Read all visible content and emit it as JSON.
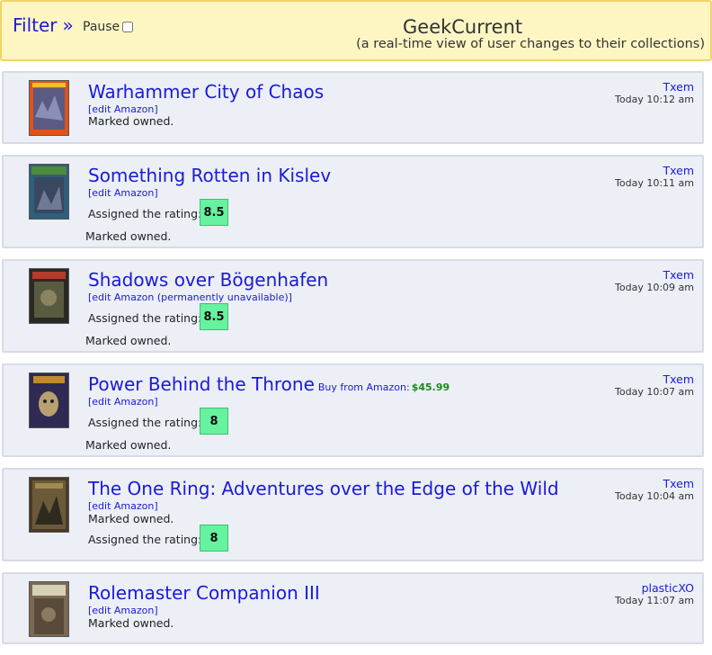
{
  "header": {
    "filter_label": "Filter",
    "filter_arrow": "»",
    "pause_label": "Pause",
    "pause_checked": false,
    "title": "GeekCurrent",
    "subtitle": "(a real-time view of user changes to their collections)"
  },
  "entries": [
    {
      "title": "Warhammer City of Chaos",
      "edit": "[edit Amazon]",
      "marked": "Marked owned.",
      "user": "Txem",
      "time": "Today 10:12 am"
    },
    {
      "title": "Something Rotten in Kislev",
      "edit": "[edit Amazon]",
      "rating_label": "Assigned the rating:",
      "rating": "8.5",
      "marked": "Marked owned.",
      "user": "Txem",
      "time": "Today 10:11 am"
    },
    {
      "title": "Shadows over Bögenhafen",
      "edit": "[edit Amazon (permanently unavailable)]",
      "rating_label": "Assigned the rating:",
      "rating": "8.5",
      "marked": "Marked owned.",
      "user": "Txem",
      "time": "Today 10:09 am"
    },
    {
      "title": "Power Behind the Throne",
      "buy_label": "Buy from Amazon:",
      "price": "$45.99",
      "edit": "[edit Amazon]",
      "rating_label": "Assigned the rating:",
      "rating": "8",
      "marked": "Marked owned.",
      "user": "Txem",
      "time": "Today 10:07 am"
    },
    {
      "title": "The One Ring: Adventures over the Edge of the Wild",
      "edit": "[edit Amazon]",
      "marked": "Marked owned.",
      "rating_label": "Assigned the rating:",
      "rating": "8",
      "user": "Txem",
      "time": "Today 10:04 am"
    },
    {
      "title": "Rolemaster Companion III",
      "edit": "[edit Amazon]",
      "marked": "Marked owned.",
      "user": "plasticXO",
      "time": "Today 11:07 am"
    }
  ],
  "colors": {
    "header_bg": "#fdf6c3",
    "header_border": "#f3d36a",
    "card_bg": "#eceff6",
    "link": "#1a1ad8",
    "rating_bg": "#67f29f",
    "price": "#1a8a1a"
  }
}
